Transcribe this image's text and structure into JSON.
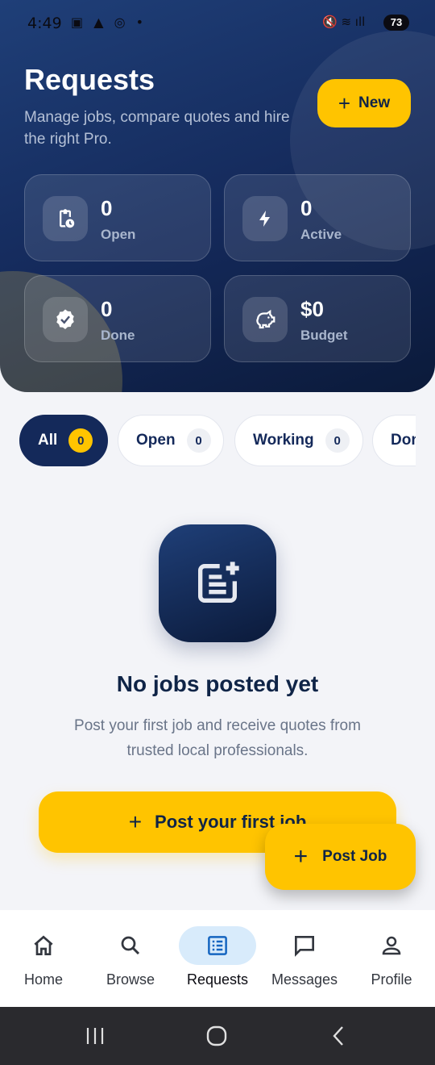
{
  "status_bar": {
    "time": "4:49",
    "left_icons": "▣ ▲ ◎ •",
    "right_icons": "🔇 ≋ ıll",
    "battery": "73"
  },
  "header": {
    "title": "Requests",
    "subtitle": "Manage jobs, compare quotes and hire the right Pro.",
    "new_button": {
      "icon": "plus-icon",
      "label": "New"
    }
  },
  "stats": [
    {
      "icon": "clipboard-clock-icon",
      "value": "0",
      "label": "Open"
    },
    {
      "icon": "bolt-icon",
      "value": "0",
      "label": "Active"
    },
    {
      "icon": "verified-badge-icon",
      "value": "0",
      "label": "Done"
    },
    {
      "icon": "piggy-bank-icon",
      "value": "$0",
      "label": "Budget"
    }
  ],
  "filters": [
    {
      "label": "All",
      "count": "0",
      "active": true
    },
    {
      "label": "Open",
      "count": "0"
    },
    {
      "label": "Working",
      "count": "0"
    },
    {
      "label": "Don",
      "count": ""
    }
  ],
  "empty_state": {
    "icon": "post-add-icon",
    "title": "No jobs posted yet",
    "text": "Post your first job and receive quotes from trusted local professionals.",
    "cta": {
      "icon": "plus-icon",
      "label": "Post your first job"
    }
  },
  "fab": {
    "icon": "plus-icon",
    "label": "Post Job"
  },
  "bottom_nav": [
    {
      "icon": "home-icon",
      "label": "Home"
    },
    {
      "icon": "search-icon",
      "label": "Browse"
    },
    {
      "icon": "list-alt-icon",
      "label": "Requests",
      "active": true
    },
    {
      "icon": "message-icon",
      "label": "Messages"
    },
    {
      "icon": "person-icon",
      "label": "Profile"
    }
  ],
  "colors": {
    "navy": "#14295a",
    "accent": "#ffc400",
    "active_nav_bg": "#d8ebfb",
    "background": "#f3f4f8"
  }
}
